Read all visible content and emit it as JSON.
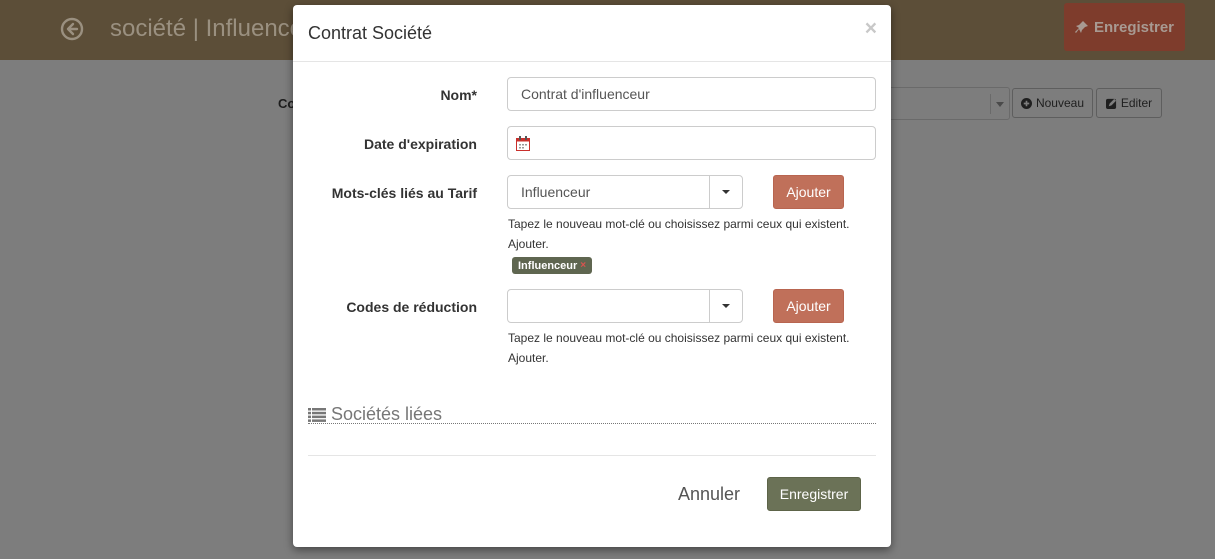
{
  "background": {
    "page_title": "société | Influence",
    "save_label": "Enregistrer",
    "field_label": "Co",
    "new_label": "Nouveau",
    "edit_label": "Editer"
  },
  "modal": {
    "title": "Contrat Société",
    "close_glyph": "×",
    "fields": {
      "name": {
        "label": "Nom*",
        "value": "Contrat d'influenceur"
      },
      "expiration": {
        "label": "Date d'expiration",
        "value": ""
      },
      "tariff_keywords": {
        "label": "Mots-clés liés au Tarif",
        "selected": "Influenceur",
        "add_label": "Ajouter",
        "help_line1": "Tapez le nouveau mot-clé ou choisissez parmi ceux qui existent.",
        "help_line2": "Ajouter.",
        "tags": [
          "Influenceur"
        ],
        "tag_remove_glyph": "×"
      },
      "discount_codes": {
        "label": "Codes de réduction",
        "selected": "",
        "add_label": "Ajouter",
        "help_line1": "Tapez le nouveau mot-clé ou choisissez parmi ceux qui existent.",
        "help_line2": "Ajouter."
      }
    },
    "linked_section": {
      "title": "Sociétés liées"
    },
    "footer": {
      "cancel_label": "Annuler",
      "save_label": "Enregistrer"
    }
  },
  "colors": {
    "accent_orange": "#c0705a",
    "save_green": "#6b7257",
    "tag_bg": "#5f6650"
  },
  "icons": [
    "back-arrow-icon",
    "pin-icon",
    "plus-circle-icon",
    "edit-icon",
    "calendar-icon",
    "list-icon"
  ]
}
